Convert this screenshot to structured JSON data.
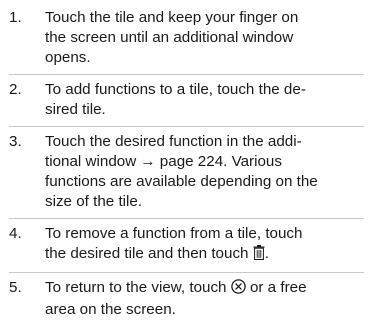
{
  "steps": [
    {
      "number": "1.",
      "lines": [
        "Touch the tile and keep your finger on",
        "the screen until an additional window",
        "opens."
      ]
    },
    {
      "number": "2.",
      "lines": [
        "To add functions to a tile, touch the de-",
        "sired tile."
      ]
    },
    {
      "number": "3.",
      "lines": [
        "Touch the desired function in the addi-",
        "tional window → page 224. Various",
        "functions are available depending on the",
        "size of the tile."
      ]
    },
    {
      "number": "4.",
      "lines_before_icon": [
        "To remove a function from a tile, touch"
      ],
      "line_with_icon_prefix": "the desired tile and then touch ",
      "icon": "trash-icon",
      "line_with_icon_suffix": "."
    },
    {
      "number": "5.",
      "line_with_icon_prefix": "To return to the view, touch ",
      "icon": "close-circle-icon",
      "line_with_icon_suffix": " or a free",
      "lines_after": [
        "area on the screen."
      ]
    }
  ]
}
